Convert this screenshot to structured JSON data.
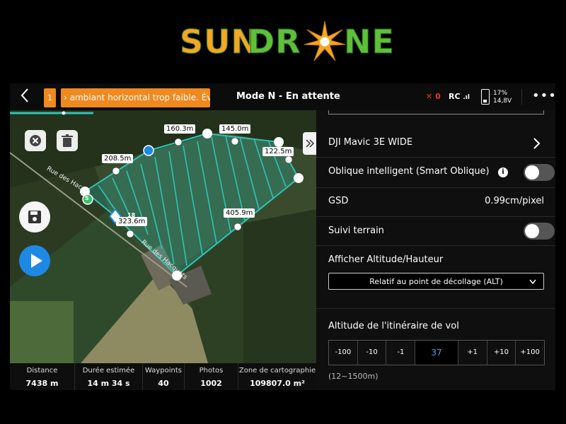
{
  "logo": {
    "part1": "SUN",
    "part2": "DR",
    "part3": "NE"
  },
  "topbar": {
    "back_icon": "chevron-left-icon",
    "warning_count": "1",
    "warning_text": "› ambiant horizontal trop faible. Év",
    "mode": "Mode N - En attente",
    "rc_warning": "0",
    "rc_label": "RC",
    "battery_percent": "17%",
    "battery_voltage": "14,8V",
    "more_icon": "more-icon"
  },
  "map": {
    "distances": [
      "160.3m",
      "145.0m",
      "208.5m",
      "122.5m",
      "405.9m",
      "323.6m"
    ],
    "start_marker": "S",
    "small_label": "18",
    "street_1": "Rue des Hac",
    "street_2": "Rue des Hacquets",
    "polygon_color": "#2ec4b6",
    "collapse_icon": "double-chevron-right-icon"
  },
  "stats": [
    {
      "label": "Distance",
      "value": "7438 m"
    },
    {
      "label": "Durée estimée",
      "value": "14 m 34 s"
    },
    {
      "label": "Waypoints",
      "value": "40"
    },
    {
      "label": "Photos",
      "value": "1002"
    },
    {
      "label": "Zone de cartographie",
      "value": "109807.0 m²"
    }
  ],
  "panel": {
    "camera": "DJI Mavic 3E WIDE",
    "smart_oblique": "Oblique intelligent (Smart Oblique)",
    "smart_oblique_on": false,
    "gsd_label": "GSD",
    "gsd_value": "0.99cm/pixel",
    "terrain_follow": "Suivi terrain",
    "terrain_follow_on": false,
    "altitude_display_label": "Afficher Altitude/Hauteur",
    "altitude_display_value": "Relatif au point de décollage (ALT)",
    "route_altitude_label": "Altitude de l'itinéraire de vol",
    "stepper": [
      "-100",
      "-10",
      "-1",
      "37",
      "+1",
      "+10",
      "+100"
    ],
    "range": "(12~1500m)"
  },
  "colors": {
    "accent_orange": "#f0891e",
    "play_blue": "#1e88e5",
    "selected_blue": "#4aa3df"
  }
}
